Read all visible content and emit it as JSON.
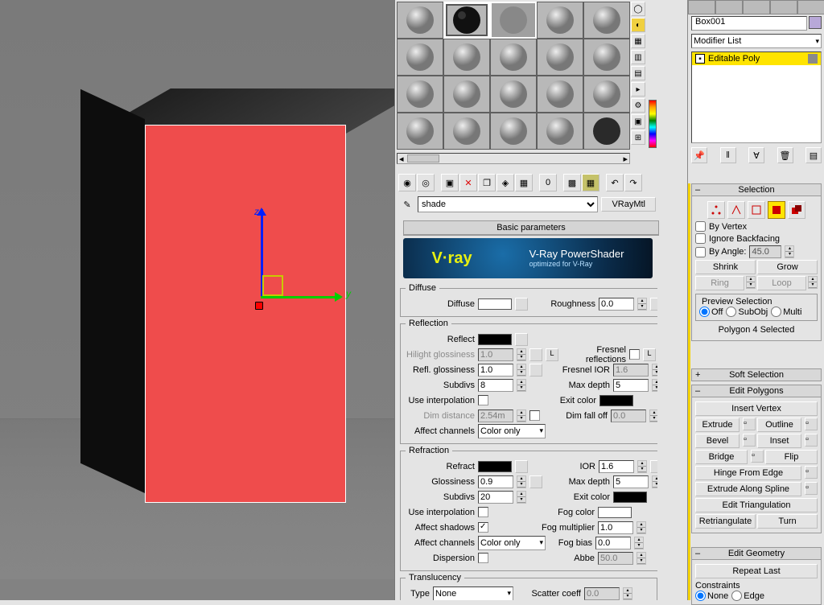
{
  "viewport": {
    "axis_z": "z",
    "axis_y": "y"
  },
  "materialEditor": {
    "nameField": "shade",
    "typeButton": "VRayMtl",
    "basicParamsTitle": "Basic parameters",
    "banner": {
      "logo": "V·ray",
      "title": "V-Ray PowerShader",
      "sub": "optimized for V-Ray"
    },
    "diffuse": {
      "legend": "Diffuse",
      "label": "Diffuse",
      "roughnessLabel": "Roughness",
      "roughness": "0.0"
    },
    "reflection": {
      "legend": "Reflection",
      "reflectLabel": "Reflect",
      "hilightLabel": "Hilight glossiness",
      "hilight": "1.0",
      "reflGlossLabel": "Refl. glossiness",
      "reflGloss": "1.0",
      "subdivsLabel": "Subdivs",
      "subdivs": "8",
      "useInterpLabel": "Use interpolation",
      "dimDistLabel": "Dim distance",
      "dimDist": "2.54m",
      "affectChLabel": "Affect channels",
      "affectCh": "Color only",
      "fresnelLabel": "Fresnel reflections",
      "fresnelIORLabel": "Fresnel IOR",
      "fresnelIOR": "1.6",
      "maxDepthLabel": "Max depth",
      "maxDepth": "5",
      "exitColorLabel": "Exit color",
      "dimFalloffLabel": "Dim fall off",
      "dimFalloff": "0.0"
    },
    "refraction": {
      "legend": "Refraction",
      "refractLabel": "Refract",
      "glossLabel": "Glossiness",
      "gloss": "0.9",
      "subdivsLabel": "Subdivs",
      "subdivs": "20",
      "useInterpLabel": "Use interpolation",
      "affectShadowsLabel": "Affect shadows",
      "affectChLabel": "Affect channels",
      "affectCh": "Color only",
      "dispersionLabel": "Dispersion",
      "iorLabel": "IOR",
      "ior": "1.6",
      "maxDepthLabel": "Max depth",
      "maxDepth": "5",
      "exitColorLabel": "Exit color",
      "fogColorLabel": "Fog color",
      "fogMultLabel": "Fog multiplier",
      "fogMult": "1.0",
      "fogBiasLabel": "Fog bias",
      "fogBias": "0.0",
      "abbeLabel": "Abbe",
      "abbe": "50.0"
    },
    "translucency": {
      "legend": "Translucency",
      "typeLabel": "Type",
      "type": "None",
      "scatterLabel": "Scatter coeff",
      "scatter": "0.0"
    }
  },
  "commandPanel": {
    "objectName": "Box001",
    "modifierListLabel": "Modifier List",
    "stackItem": "Editable Poly",
    "selection": {
      "title": "Selection",
      "byVertex": "By Vertex",
      "ignoreBackfacing": "Ignore Backfacing",
      "byAngle": "By Angle:",
      "angle": "45.0",
      "shrink": "Shrink",
      "grow": "Grow",
      "ring": "Ring",
      "loop": "Loop",
      "previewTitle": "Preview Selection",
      "off": "Off",
      "subobj": "SubObj",
      "multi": "Multi",
      "status": "Polygon 4 Selected"
    },
    "softSelection": {
      "title": "Soft Selection"
    },
    "editPolygons": {
      "title": "Edit Polygons",
      "insertVertex": "Insert Vertex",
      "extrude": "Extrude",
      "outline": "Outline",
      "bevel": "Bevel",
      "inset": "Inset",
      "bridge": "Bridge",
      "flip": "Flip",
      "hingeFromEdge": "Hinge From Edge",
      "extrudeAlongSpline": "Extrude Along Spline",
      "editTriangulation": "Edit Triangulation",
      "retriangulate": "Retriangulate",
      "turn": "Turn"
    },
    "editGeometry": {
      "title": "Edit Geometry",
      "repeatLast": "Repeat Last",
      "constraints": "Constraints",
      "none": "None",
      "edge": "Edge"
    }
  }
}
